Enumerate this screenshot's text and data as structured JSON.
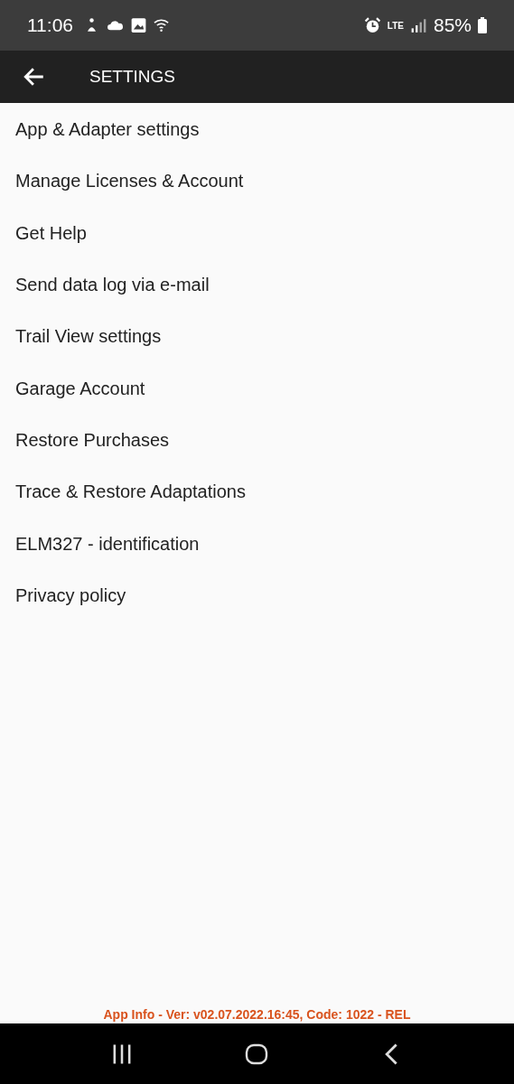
{
  "status_bar": {
    "time": "11:06",
    "network": "LTE",
    "battery": "85%"
  },
  "app_bar": {
    "title": "SETTINGS"
  },
  "menu_items": [
    {
      "label": "App & Adapter settings"
    },
    {
      "label": "Manage Licenses & Account"
    },
    {
      "label": "Get Help"
    },
    {
      "label": "Send data log via e-mail"
    },
    {
      "label": "Trail View settings"
    },
    {
      "label": "Garage Account"
    },
    {
      "label": "Restore Purchases"
    },
    {
      "label": "Trace & Restore Adaptations"
    },
    {
      "label": "ELM327 - identification"
    },
    {
      "label": "Privacy policy"
    }
  ],
  "footer": "App Info - Ver: v02.07.2022.16:45, Code: 1022 - REL"
}
